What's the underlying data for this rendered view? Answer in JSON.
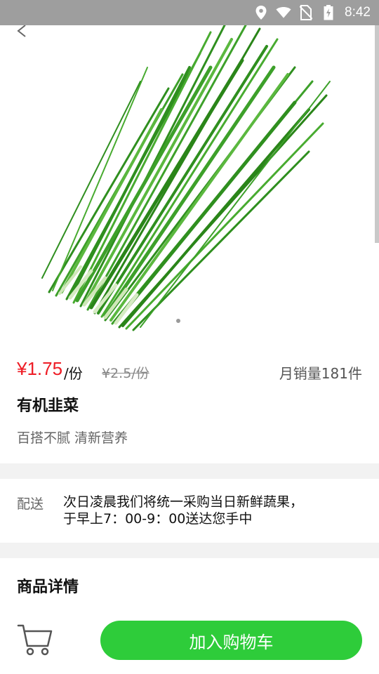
{
  "status_bar": {
    "time": "8:42",
    "icons": [
      "location-icon",
      "wifi-icon",
      "no-sim-icon",
      "battery-charging-icon"
    ]
  },
  "product": {
    "price": "¥1.75",
    "unit": "/份",
    "original_price": "¥2.5/份",
    "monthly_sales": "月销量181件",
    "name": "有机韭菜",
    "tagline": "百搭不腻 清新营养",
    "image_icon": "chives-image",
    "carousel": {
      "current_page": 1,
      "total_pages": 1
    }
  },
  "delivery": {
    "label": "配送",
    "line1": "次日凌晨我们将统一采购当日新鲜蔬果，",
    "line2": "于早上7：00-9：00送达您手中"
  },
  "details": {
    "title": "商品详情"
  },
  "bottom_bar": {
    "cart_icon": "shopping-cart-icon",
    "add_to_cart_label": "加入购物车"
  },
  "colors": {
    "price_red": "#ee1c25",
    "button_green": "#2ecc3a",
    "status_bar_gray": "#9e9e9e",
    "divider_gray": "#f2f2f2"
  }
}
